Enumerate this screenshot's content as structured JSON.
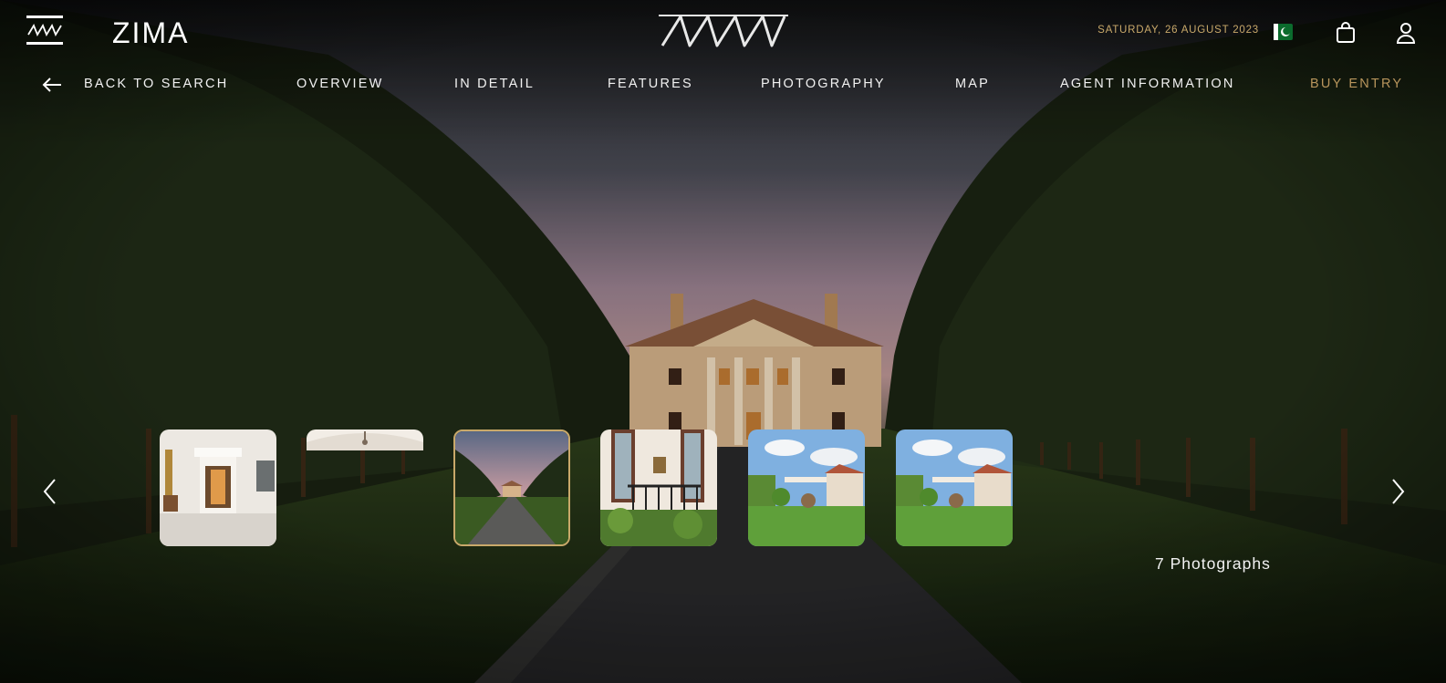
{
  "header": {
    "brand_name": "ZIMA",
    "date": "SATURDAY, 26 AUGUST 2023",
    "icons": [
      "menu-icon",
      "logo-mark",
      "flag-icon",
      "shopping-bag-icon",
      "user-icon"
    ]
  },
  "nav": {
    "back_label": "BACK TO SEARCH",
    "items": [
      "OVERVIEW",
      "IN DETAIL",
      "FEATURES",
      "PHOTOGRAPHY",
      "MAP",
      "AGENT INFORMATION"
    ],
    "buy_label": "BUY ENTRY"
  },
  "gallery": {
    "count_label": "7 Photographs",
    "active_index": 2,
    "thumbnails": [
      "interior-hall",
      "ceiling-chandelier",
      "estate-driveway",
      "terrace-doorway",
      "garden-pergola",
      "garden-pergola"
    ]
  },
  "colors": {
    "accent": "#c9a96a",
    "nav_text": "#f1f1f1",
    "background": "#0d0f0d"
  }
}
